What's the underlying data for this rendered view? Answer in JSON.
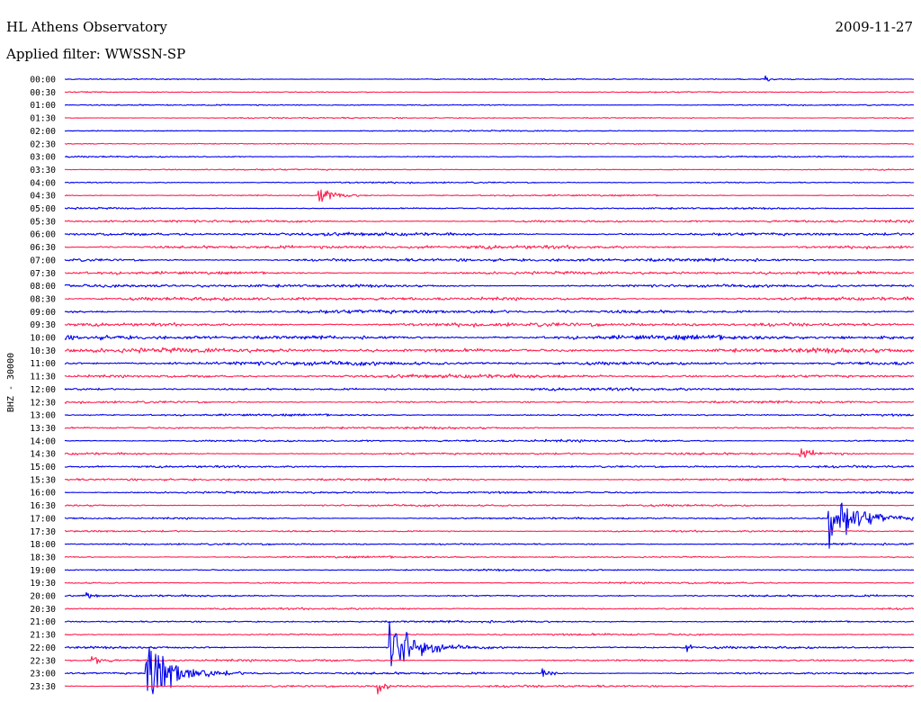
{
  "header": {
    "station": "HL Athens Observatory",
    "date": "2009-11-27",
    "filter_label": "Applied filter: WWSSN-SP"
  },
  "chart_data": {
    "type": "line",
    "subtype": "helicorder",
    "channel_label": "BHZ - 30000",
    "rows": [
      "00:00",
      "00:30",
      "01:00",
      "01:30",
      "02:00",
      "02:30",
      "03:00",
      "03:30",
      "04:00",
      "04:30",
      "05:00",
      "05:30",
      "06:00",
      "06:30",
      "07:00",
      "07:30",
      "08:00",
      "08:30",
      "09:00",
      "09:30",
      "10:00",
      "10:30",
      "11:00",
      "11:30",
      "12:00",
      "12:30",
      "13:00",
      "13:30",
      "14:00",
      "14:30",
      "15:00",
      "15:30",
      "16:00",
      "16:30",
      "17:00",
      "17:30",
      "18:00",
      "18:30",
      "19:00",
      "19:30",
      "20:00",
      "20:30",
      "21:00",
      "21:30",
      "22:00",
      "22:30",
      "23:00",
      "23:30"
    ],
    "row_minutes": 30,
    "colors": [
      "#0000ee",
      "#ff1f4f"
    ],
    "noise_amplitude": [
      0.9,
      0.9,
      0.9,
      0.9,
      0.9,
      0.9,
      0.9,
      0.9,
      1.1,
      1.1,
      1.2,
      1.7,
      2.4,
      2.6,
      2.4,
      2.2,
      2.3,
      2.4,
      2.6,
      2.9,
      3.3,
      3.1,
      3.0,
      2.6,
      2.0,
      1.6,
      1.5,
      1.5,
      1.6,
      1.6,
      1.6,
      1.6,
      1.6,
      1.5,
      1.4,
      1.3,
      1.3,
      1.3,
      1.2,
      1.2,
      1.3,
      1.4,
      1.4,
      1.4,
      1.5,
      1.5,
      1.6,
      1.6
    ],
    "events": [
      {
        "row": "04:30",
        "minute": 9.0,
        "amplitude": 13,
        "duration_minutes": 1.2
      },
      {
        "row": "17:00",
        "minute": 27.0,
        "amplitude": 45,
        "duration_minutes": 2.0
      },
      {
        "row": "22:00",
        "minute": 11.5,
        "amplitude": 55,
        "duration_minutes": 1.8
      },
      {
        "row": "22:30",
        "minute": 1.0,
        "amplitude": 9,
        "duration_minutes": 0.6
      },
      {
        "row": "23:00",
        "minute": 2.9,
        "amplitude": 60,
        "duration_minutes": 1.8
      },
      {
        "row": "23:00",
        "minute": 16.9,
        "amplitude": 9,
        "duration_minutes": 0.5
      },
      {
        "row": "23:30",
        "minute": 11.1,
        "amplitude": 14,
        "duration_minutes": 0.5
      },
      {
        "row": "20:00",
        "minute": 0.8,
        "amplitude": 6,
        "duration_minutes": 0.4
      },
      {
        "row": "22:00",
        "minute": 22.0,
        "amplitude": 5,
        "duration_minutes": 0.4
      },
      {
        "row": "14:30",
        "minute": 26.0,
        "amplitude": 6,
        "duration_minutes": 1.5
      },
      {
        "row": "00:00",
        "minute": 24.8,
        "amplitude": 4,
        "duration_minutes": 0.3
      }
    ]
  }
}
